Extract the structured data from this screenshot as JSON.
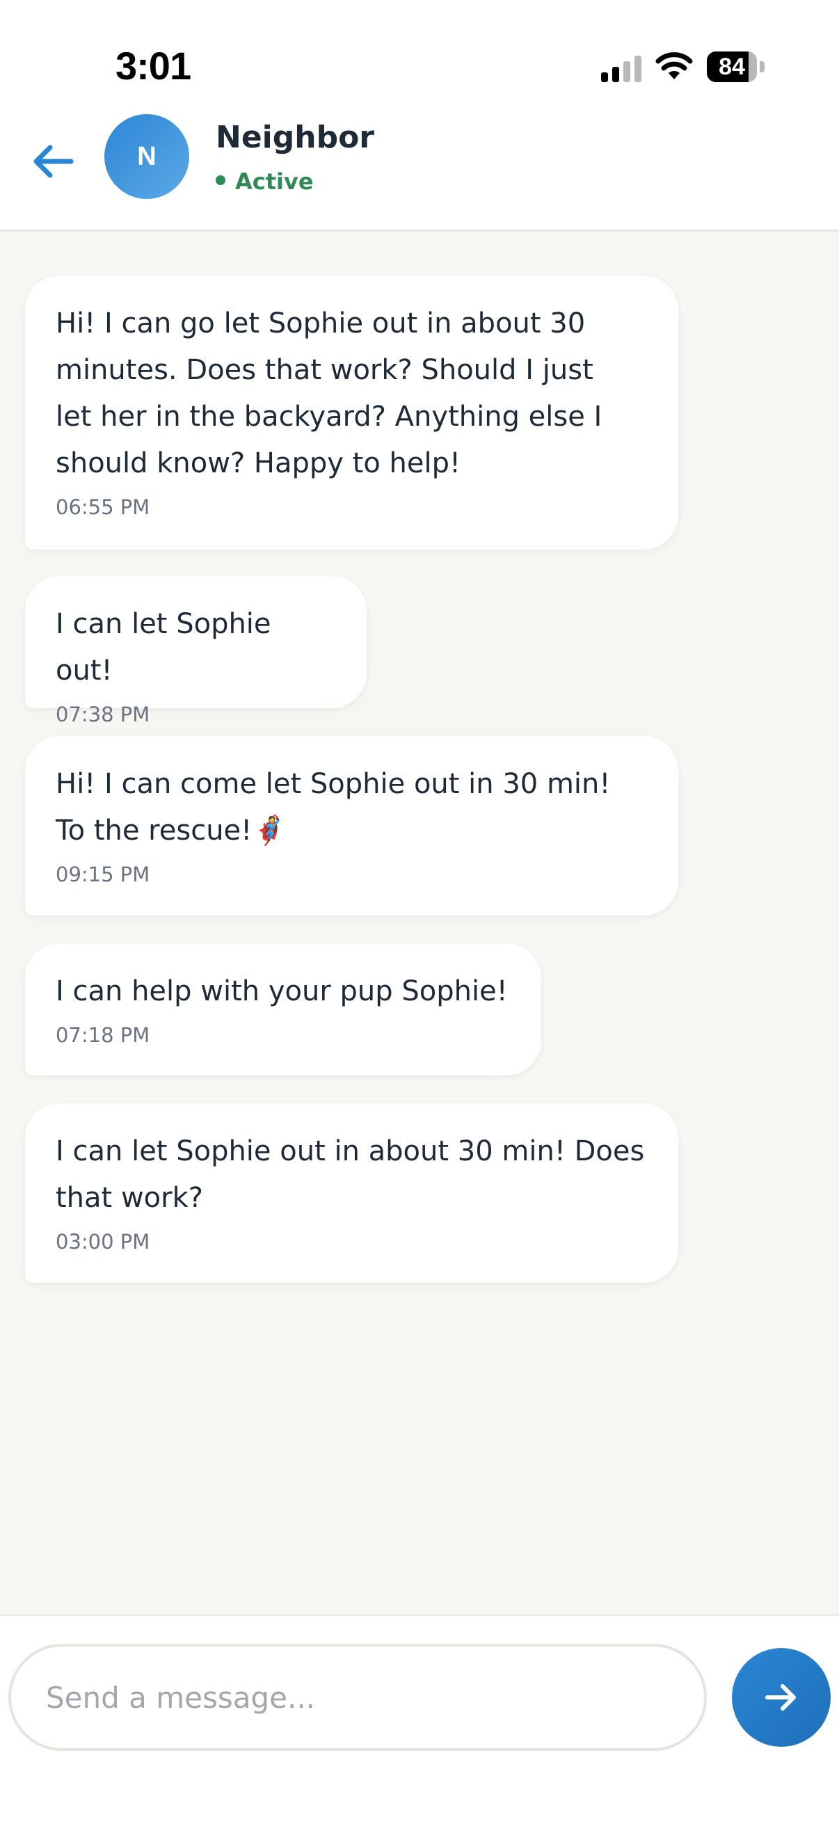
{
  "status_bar": {
    "time": "3:01",
    "battery_level": "84",
    "battery_fraction": 0.84,
    "signal_bars_active": 2,
    "signal_bars_total": 4
  },
  "header": {
    "back_icon": "arrow-left-icon",
    "avatar_initial": "N",
    "contact_name": "Neighbor",
    "contact_status": "Active",
    "status_color": "#2f8a55"
  },
  "messages": [
    {
      "text": "Hi! I can go let Sophie out in about 30\nminutes. Does that work? Should I just\nlet her in the backyard? Anything else I\nshould know? Happy to help!",
      "time": "06:55 PM"
    },
    {
      "text": "I can let Sophie out!",
      "time": "07:38 PM"
    },
    {
      "text": "Hi! I can come let Sophie out in 30 min!\nTo the rescue!🦸",
      "time": "09:15 PM"
    },
    {
      "text": "I can help with your pup Sophie!",
      "time": "07:18 PM"
    },
    {
      "text": "I can let Sophie out in about 30 min! Does\nthat work?",
      "time": "03:00 PM"
    }
  ],
  "composer": {
    "placeholder": "Send a message...",
    "value": "",
    "send_icon": "arrow-right-icon"
  },
  "colors": {
    "accent": "#2a86d4",
    "background": "#f7f6f3",
    "bubble": "#ffffff",
    "text": "#1f2a37",
    "muted": "#6b7280"
  }
}
